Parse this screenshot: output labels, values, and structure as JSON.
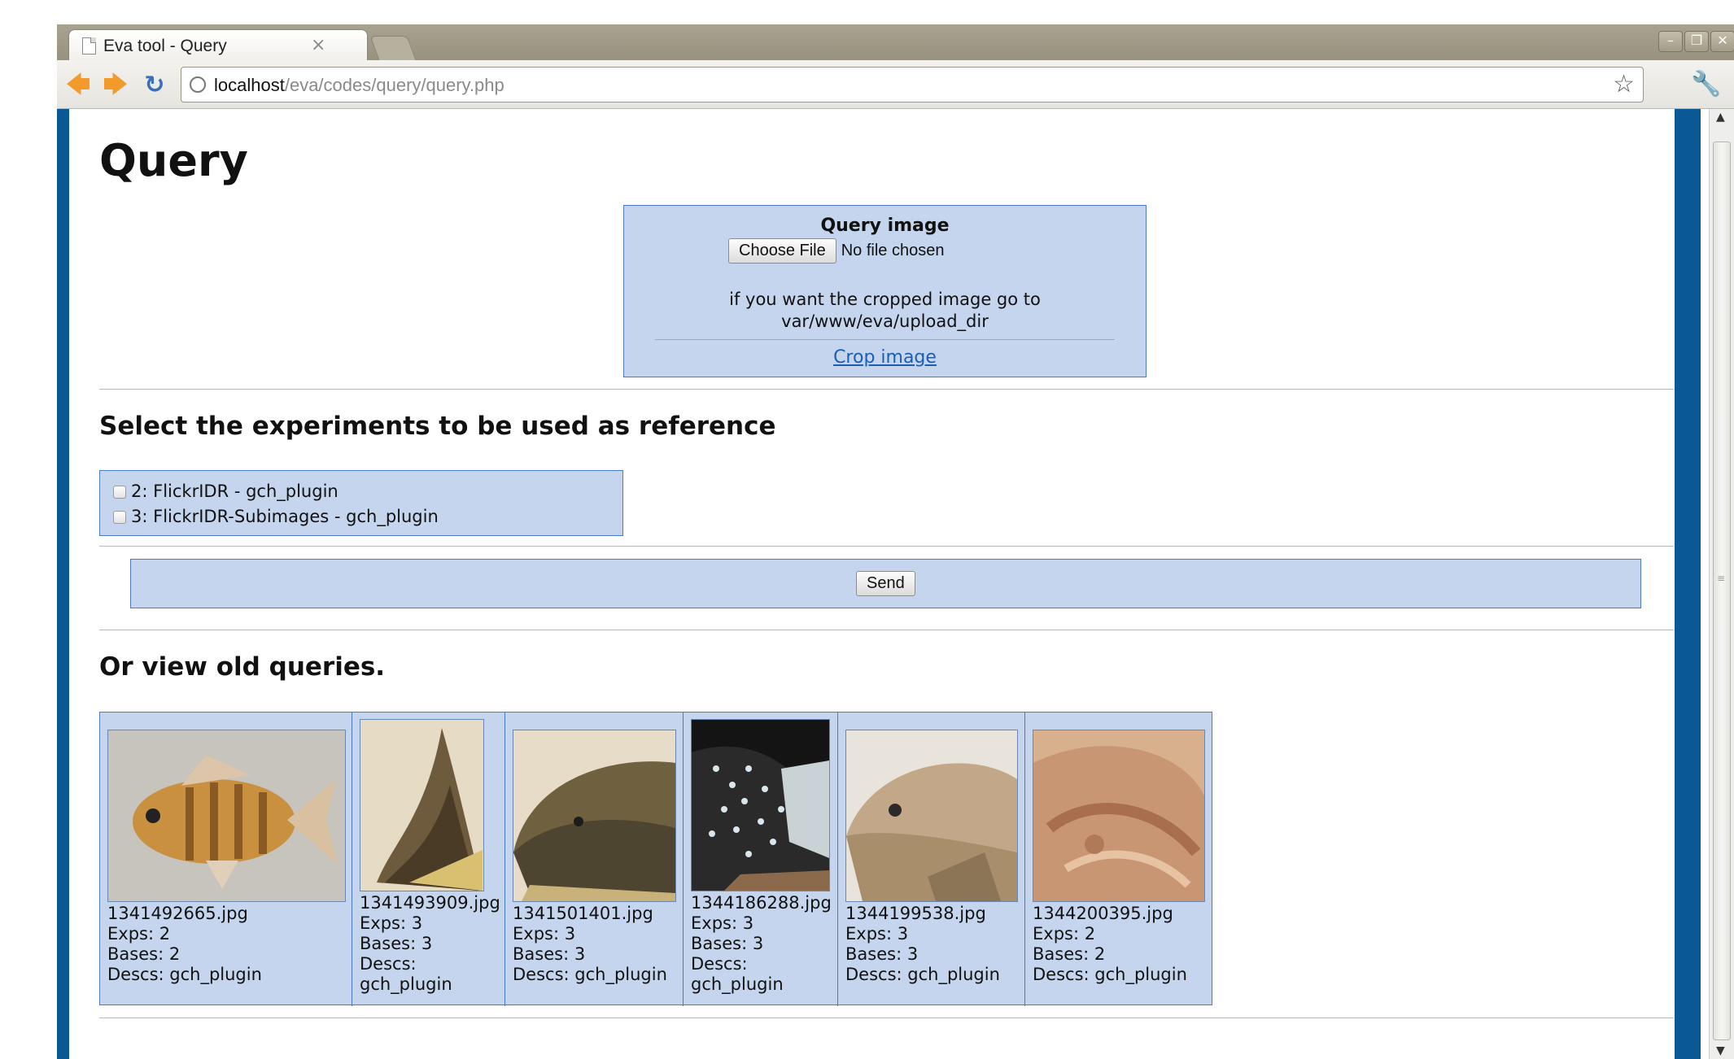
{
  "browser": {
    "tab_title": "Eva tool - Query",
    "tab_close": "×",
    "url_host": "localhost",
    "url_path": "/eva/codes/query/query.php"
  },
  "page": {
    "title": "Query",
    "query_box": {
      "title": "Query image",
      "choose_file_label": "Choose File",
      "no_file_text": "No file chosen",
      "note_line1": "if you want the cropped image go to",
      "note_line2": "var/www/eva/upload_dir",
      "crop_link": "Crop image"
    },
    "experiments": {
      "heading": "Select the experiments to be used as reference",
      "items": [
        {
          "label": "2: FlickrIDR - gch_plugin",
          "checked": false
        },
        {
          "label": "3: FlickrIDR-Subimages - gch_plugin",
          "checked": false
        }
      ]
    },
    "send_label": "Send",
    "old_queries": {
      "heading": "Or view old queries.",
      "items": [
        {
          "file": "1341492665.jpg",
          "exps": "Exps: 2",
          "bases": "Bases: 2",
          "descs": "Descs: gch_plugin",
          "image": "fish-striped-orange"
        },
        {
          "file": "1341493909.jpg",
          "exps": "Exps: 3",
          "bases": "Bases: 3",
          "descs_label": "Descs:",
          "descs_value": "gch_plugin",
          "image": "fish-tail"
        },
        {
          "file": "1341501401.jpg",
          "exps": "Exps: 3",
          "bases": "Bases: 3",
          "descs": "Descs: gch_plugin",
          "image": "fish-catfish-head"
        },
        {
          "file": "1344186288.jpg",
          "exps": "Exps: 3",
          "bases": "Bases: 3",
          "descs_label": "Descs:",
          "descs_value": "gch_plugin",
          "image": "fish-spotted-dark"
        },
        {
          "file": "1344199538.jpg",
          "exps": "Exps: 3",
          "bases": "Bases: 3",
          "descs": "Descs: gch_plugin",
          "image": "fish-head-beige"
        },
        {
          "file": "1344200395.jpg",
          "exps": "Exps: 2",
          "bases": "Bases: 2",
          "descs": "Descs: gch_plugin",
          "image": "fish-specimen-pink"
        }
      ]
    }
  },
  "colors": {
    "accent_border": "#0a5896",
    "panel_bg": "#c5d5ee",
    "panel_border": "#4b7bc4",
    "link": "#1b5fb3"
  }
}
